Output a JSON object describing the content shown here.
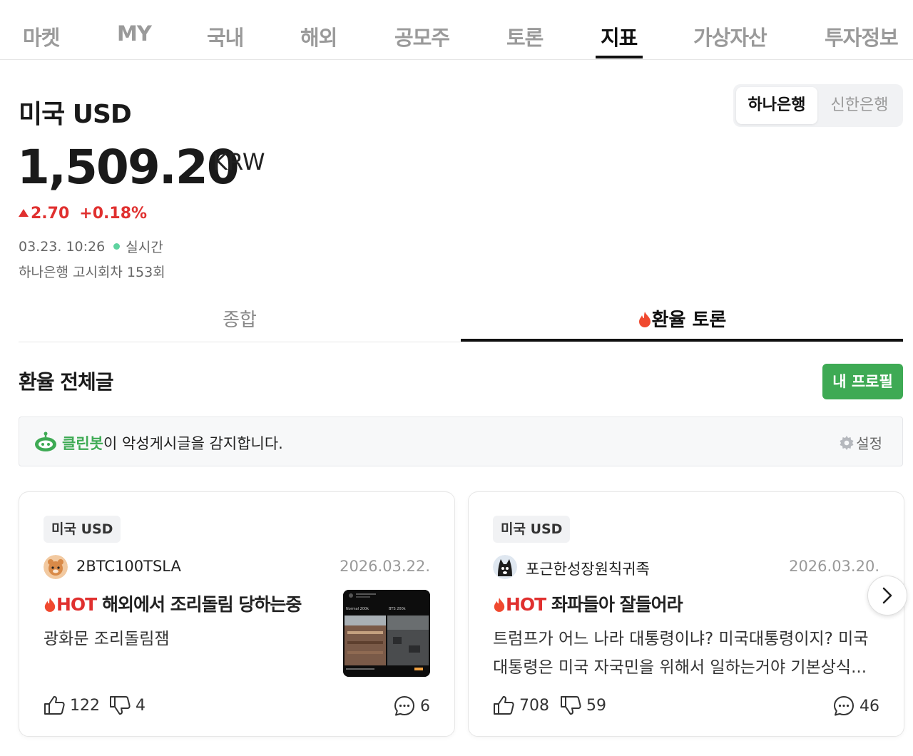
{
  "nav": {
    "tabs": [
      {
        "label": "마켓"
      },
      {
        "label": "MY"
      },
      {
        "label": "국내"
      },
      {
        "label": "해외"
      },
      {
        "label": "공모주"
      },
      {
        "label": "토론"
      },
      {
        "label": "지표"
      },
      {
        "label": "가상자산"
      },
      {
        "label": "투자정보"
      }
    ],
    "active_tab": "지표"
  },
  "header": {
    "title": "미국 USD",
    "banks": [
      "하나은행",
      "신한은행"
    ],
    "selected_bank": "하나은행",
    "price": "1,509.20",
    "currency": "KRW",
    "change": "2.70",
    "change_pct": "+0.18%",
    "timestamp": "03.23. 10:26",
    "live_label": "실시간",
    "notice_round": "하나은행 고시회차 153회"
  },
  "subtabs": {
    "items": [
      "종합",
      "환율 토론"
    ],
    "active": "환율 토론"
  },
  "board": {
    "title": "환율 전체글",
    "profile_button": "내 프로필",
    "cleanbot": {
      "name": "클린봇",
      "message": "이 악성게시글을 감지합니다.",
      "settings": "설정"
    },
    "posts": [
      {
        "tag": "미국 USD",
        "author": "2BTC100TSLA",
        "date": "2026.03.22.",
        "hot": "HOT",
        "title": "해외에서 조리돌림 당하는중",
        "body": "광화문 조리돌림잼",
        "likes": "122",
        "dislikes": "4",
        "comments": "6",
        "thumb_labels": [
          "Normal 200k",
          "BTS 200k"
        ]
      },
      {
        "tag": "미국 USD",
        "author": "포근한성장원칙귀족",
        "date": "2026.03.20.",
        "hot": "HOT",
        "title": "좌파들아 잘들어라",
        "body": "트럼프가 어느 나라 대통령이냐? 미국대통령이지? 미국대통령은 미국 자국민을 위해서 일하는거야 기본상식...",
        "likes": "708",
        "dislikes": "59",
        "comments": "46"
      }
    ]
  },
  "colors": {
    "accent_red": "#e0302f",
    "accent_green": "#3eaa54",
    "live_dot": "#5fd3a0"
  }
}
